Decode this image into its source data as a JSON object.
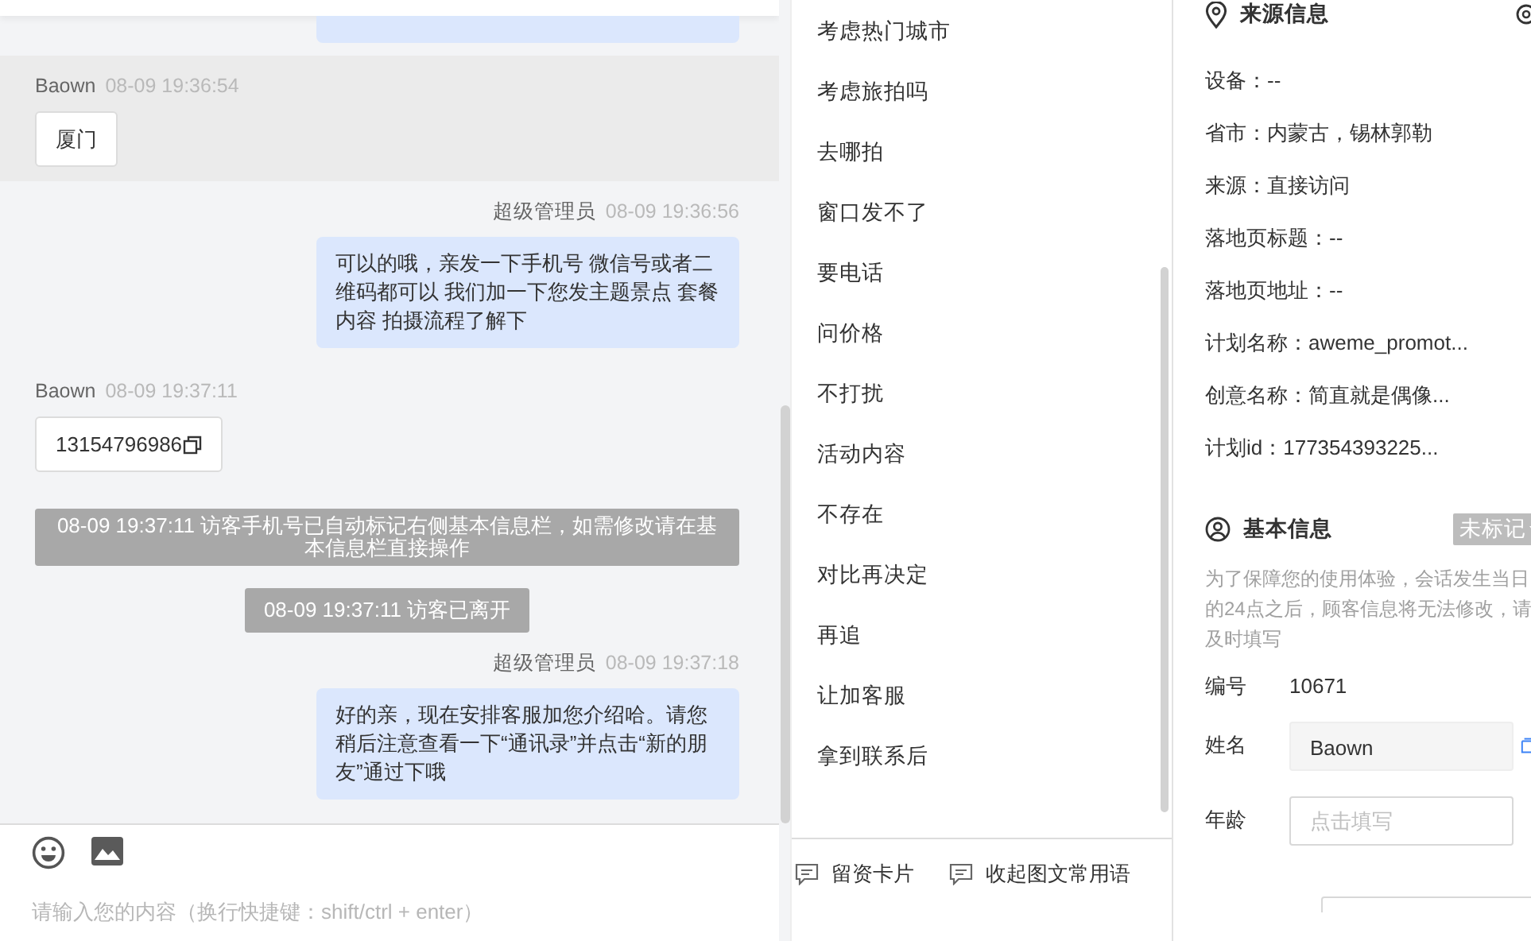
{
  "chat": {
    "messages": [
      {
        "kind": "visitor",
        "sender": "Baown",
        "time": "08-09 19:36:54",
        "text": "厦门",
        "highlighted": true,
        "copyable": false
      },
      {
        "kind": "agent",
        "sender": "超级管理员",
        "time": "08-09 19:36:56",
        "text": "可以的哦，亲发一下手机号 微信号或者二维码都可以 我们加一下您发主题景点 套餐内容 拍摄流程了解下"
      },
      {
        "kind": "visitor",
        "sender": "Baown",
        "time": "08-09 19:37:11",
        "text": "13154796986",
        "highlighted": false,
        "copyable": true
      },
      {
        "kind": "system",
        "text": "08-09 19:37:11 访客手机号已自动标记右侧基本信息栏，如需修改请在基本信息栏直接操作"
      },
      {
        "kind": "system",
        "text": "08-09 19:37:11 访客已离开"
      },
      {
        "kind": "agent",
        "sender": "超级管理员",
        "time": "08-09 19:37:18",
        "text": "好的亲，现在安排客服加您介绍哈。请您稍后注意查看一下“通讯录”并点击“新的朋友”通过下哦"
      }
    ],
    "composer": {
      "placeholder": "请输入您的内容（换行快捷键：shift/ctrl + enter）"
    }
  },
  "quick_replies": {
    "items": [
      "考虑热门城市",
      "考虑旅拍吗",
      "去哪拍",
      "窗口发不了",
      "要电话",
      "问价格",
      "不打扰",
      "活动内容",
      "不存在",
      "对比再决定",
      "再追",
      "让加客服",
      "拿到联系后"
    ],
    "actions": [
      "留资卡片",
      "收起图文常用语"
    ]
  },
  "source_info": {
    "title": "来源信息",
    "rows": [
      "设备：--",
      "省市：内蒙古，锡林郭勒",
      "来源：直接访问",
      "落地页标题：--",
      "落地页地址：--",
      "计划名称：aweme_promot...",
      "创意名称：简直就是偶像...",
      "计划id：177354393225..."
    ]
  },
  "basic_info": {
    "title": "基本信息",
    "tag": "未标记",
    "notice": "为了保障您的使用体验，会话发生当日的24点之后，顾客信息将无法修改，请及时填写",
    "fields": [
      {
        "kind": "text",
        "label": "编号",
        "value": "10671"
      },
      {
        "kind": "readonly",
        "label": "姓名",
        "value": "Baown"
      },
      {
        "kind": "input",
        "label": "年龄",
        "placeholder": "点击填写"
      }
    ]
  }
}
